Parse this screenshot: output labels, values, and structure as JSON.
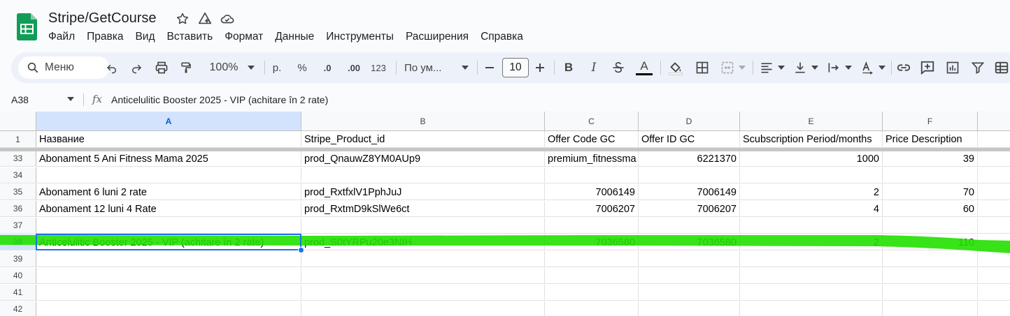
{
  "app": {
    "doc_title": "Stripe/GetCourse",
    "menu": [
      "Файл",
      "Правка",
      "Вид",
      "Вставить",
      "Формат",
      "Данные",
      "Инструменты",
      "Расширения",
      "Справка"
    ]
  },
  "toolbar": {
    "search_label": "Меню",
    "zoom": "100%",
    "currency": "р.",
    "percent": "%",
    "dec_decrease": ".0",
    "dec_increase": ".00",
    "number_format": "123",
    "font_name": "По ум...",
    "font_size": "10"
  },
  "formula_bar": {
    "cell_ref": "A38",
    "fx": "fx",
    "content": "Anticelulitic Booster 2025 - VIP (achitare în 2 rate)"
  },
  "sheet": {
    "columns": [
      "A",
      "B",
      "C",
      "D",
      "E",
      "F"
    ],
    "rows": [
      {
        "num": "1",
        "cells": [
          "Название",
          "Stripe_Product_id",
          "Offer Code GC",
          "Offer ID GC",
          "Scubscription Period/months",
          "Price Description"
        ]
      },
      {
        "num": "33",
        "cells": [
          "Abonament 5 Ani Fitness Mama 2025",
          "prod_QnauwZ8YM0AUp9",
          "premium_fitnessma",
          "6221370",
          "1000",
          "39"
        ]
      },
      {
        "num": "34",
        "cells": [
          "",
          "",
          "",
          "",
          "",
          ""
        ]
      },
      {
        "num": "35",
        "cells": [
          "Abonament 6 luni 2 rate",
          "prod_RxtfxlV1PphJuJ",
          "7006149",
          "7006149",
          "2",
          "70"
        ]
      },
      {
        "num": "36",
        "cells": [
          "Abonament 12 luni 4 Rate",
          "prod_RxtmD9kSlWe6ct",
          "7006207",
          "7006207",
          "4",
          "60"
        ]
      },
      {
        "num": "37",
        "cells": [
          "",
          "",
          "",
          "",
          "",
          ""
        ]
      },
      {
        "num": "38",
        "cells": [
          "Anticelulitic Booster 2025 - VIP (achitare în 2 rate)",
          "prod_S0tYRPu20e3NIH",
          "7036580",
          "7036580",
          "2",
          "110"
        ]
      },
      {
        "num": "39",
        "cells": [
          "",
          "",
          "",
          "",
          "",
          ""
        ]
      },
      {
        "num": "40",
        "cells": [
          "",
          "",
          "",
          "",
          "",
          ""
        ]
      },
      {
        "num": "41",
        "cells": [
          "",
          "",
          "",
          "",
          "",
          ""
        ]
      },
      {
        "num": "42",
        "cells": [
          "",
          "",
          "",
          "",
          "",
          ""
        ]
      }
    ],
    "active_cell": "A38",
    "highlight_color": "#22e000",
    "accent_color": "#1a73e8"
  }
}
